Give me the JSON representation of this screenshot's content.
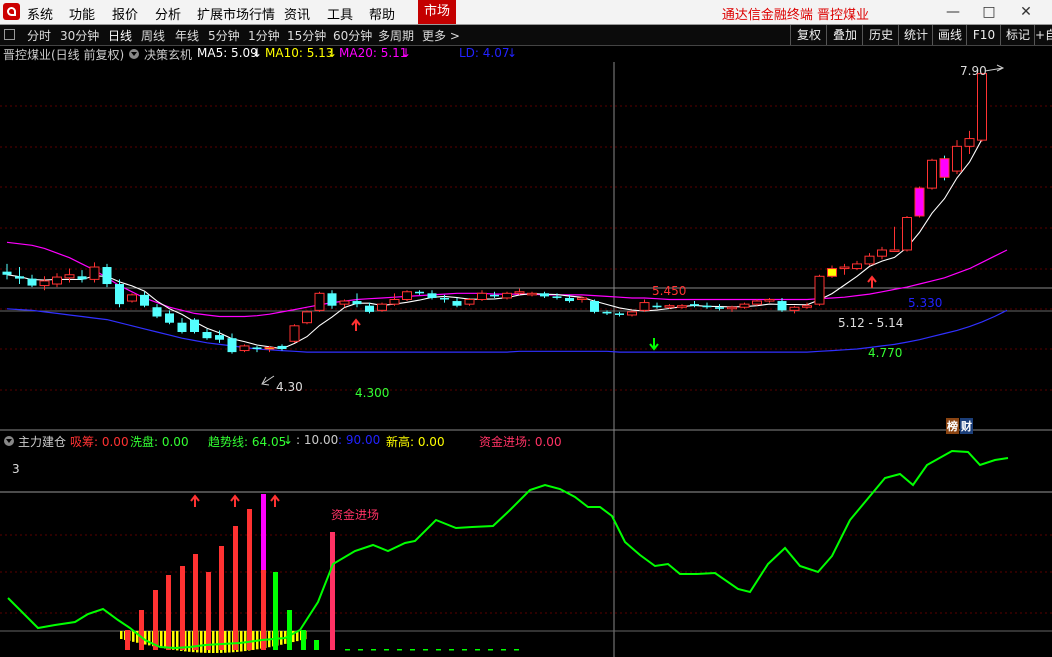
{
  "menubar": {
    "items": [
      "系统",
      "功能",
      "报价",
      "分析",
      "扩展市场行情",
      "资讯",
      "工具",
      "帮助"
    ],
    "market": "市场",
    "brand": "通达信金融终端  晋控煤业"
  },
  "timeframes": {
    "items": [
      "分时",
      "30分钟",
      "日线",
      "周线",
      "年线",
      "5分钟",
      "1分钟",
      "15分钟",
      "60分钟",
      "多周期",
      "更多 >"
    ],
    "active": "日线"
  },
  "toolbar": [
    "复权",
    "叠加",
    "历史",
    "统计",
    "画线",
    "F10",
    "标记",
    "+自"
  ],
  "main_header": {
    "title": "晋控煤业(日线 前复权)",
    "indicator": "决策玄机",
    "ma5": "MA5: 5.09",
    "ma10": "MA10: 5.13",
    "ma20": "MA20: 5.11",
    "ld": "LD: 4.07"
  },
  "annotations": {
    "high": "7.90",
    "low": "4.30",
    "low_label": "4.300",
    "mid_label": "5.450",
    "blue_label": "5.330",
    "range": "5.12 - 5.14",
    "green_label": "4.770",
    "badge1": "榜",
    "badge2": "财"
  },
  "sub_header": {
    "title": "主力建仓",
    "xichou": "吸筹: 0.00",
    "xipan": "洗盘: 0.00",
    "trend": "趋势线: 64.05",
    "ten": ": 10.00",
    "ninety": ": 90.00",
    "xingao": "新高: 0.00",
    "zijin": "资金进场: 0.00",
    "scale": "3",
    "zijin_label": "资金进场"
  },
  "colors": {
    "up": "#ff3232",
    "down": "#54ffff",
    "ma_white": "#ffffff",
    "ma_magenta": "#ff00ff",
    "ld_blue": "#3030ff",
    "trend_green": "#00ff00",
    "flag_yellow": "#ffff00"
  },
  "chart_data": {
    "type": "candlestick",
    "candles": [
      {
        "o": 5.34,
        "h": 5.44,
        "l": 5.24,
        "c": 5.3
      },
      {
        "o": 5.28,
        "h": 5.4,
        "l": 5.18,
        "c": 5.25
      },
      {
        "o": 5.25,
        "h": 5.3,
        "l": 5.14,
        "c": 5.16
      },
      {
        "o": 5.16,
        "h": 5.28,
        "l": 5.1,
        "c": 5.22
      },
      {
        "o": 5.18,
        "h": 5.32,
        "l": 5.14,
        "c": 5.27
      },
      {
        "o": 5.26,
        "h": 5.38,
        "l": 5.2,
        "c": 5.3
      },
      {
        "o": 5.28,
        "h": 5.36,
        "l": 5.2,
        "c": 5.24
      },
      {
        "o": 5.24,
        "h": 5.46,
        "l": 5.2,
        "c": 5.4
      },
      {
        "o": 5.4,
        "h": 5.44,
        "l": 5.14,
        "c": 5.18
      },
      {
        "o": 5.18,
        "h": 5.24,
        "l": 4.88,
        "c": 4.92
      },
      {
        "o": 4.96,
        "h": 5.06,
        "l": 4.94,
        "c": 5.04
      },
      {
        "o": 5.04,
        "h": 5.08,
        "l": 4.88,
        "c": 4.9
      },
      {
        "o": 4.88,
        "h": 4.92,
        "l": 4.74,
        "c": 4.76
      },
      {
        "o": 4.8,
        "h": 4.84,
        "l": 4.66,
        "c": 4.68
      },
      {
        "o": 4.68,
        "h": 4.74,
        "l": 4.54,
        "c": 4.56
      },
      {
        "o": 4.72,
        "h": 4.74,
        "l": 4.54,
        "c": 4.56
      },
      {
        "o": 4.56,
        "h": 4.6,
        "l": 4.46,
        "c": 4.48
      },
      {
        "o": 4.52,
        "h": 4.58,
        "l": 4.42,
        "c": 4.46
      },
      {
        "o": 4.48,
        "h": 4.54,
        "l": 4.28,
        "c": 4.3
      },
      {
        "o": 4.32,
        "h": 4.4,
        "l": 4.3,
        "c": 4.38
      },
      {
        "o": 4.36,
        "h": 4.38,
        "l": 4.3,
        "c": 4.34
      },
      {
        "o": 4.34,
        "h": 4.38,
        "l": 4.3,
        "c": 4.36
      },
      {
        "o": 4.38,
        "h": 4.4,
        "l": 4.32,
        "c": 4.34
      },
      {
        "o": 4.44,
        "h": 4.66,
        "l": 4.42,
        "c": 4.64
      },
      {
        "o": 4.68,
        "h": 4.84,
        "l": 4.66,
        "c": 4.82
      },
      {
        "o": 4.84,
        "h": 5.08,
        "l": 4.82,
        "c": 5.06
      },
      {
        "o": 5.06,
        "h": 5.1,
        "l": 4.86,
        "c": 4.9
      },
      {
        "o": 4.92,
        "h": 4.98,
        "l": 4.88,
        "c": 4.96
      },
      {
        "o": 4.96,
        "h": 5.06,
        "l": 4.88,
        "c": 4.92
      },
      {
        "o": 4.9,
        "h": 4.94,
        "l": 4.8,
        "c": 4.82
      },
      {
        "o": 4.84,
        "h": 4.94,
        "l": 4.82,
        "c": 4.92
      },
      {
        "o": 4.92,
        "h": 5.06,
        "l": 4.9,
        "c": 4.98
      },
      {
        "o": 4.98,
        "h": 5.1,
        "l": 4.96,
        "c": 5.08
      },
      {
        "o": 5.08,
        "h": 5.1,
        "l": 5.04,
        "c": 5.06
      },
      {
        "o": 5.06,
        "h": 5.1,
        "l": 4.98,
        "c": 5.0
      },
      {
        "o": 5.0,
        "h": 5.04,
        "l": 4.94,
        "c": 4.98
      },
      {
        "o": 4.96,
        "h": 5.0,
        "l": 4.88,
        "c": 4.9
      },
      {
        "o": 4.92,
        "h": 5.0,
        "l": 4.9,
        "c": 4.98
      },
      {
        "o": 4.98,
        "h": 5.1,
        "l": 4.96,
        "c": 5.06
      },
      {
        "o": 5.04,
        "h": 5.08,
        "l": 5.0,
        "c": 5.02
      },
      {
        "o": 5.0,
        "h": 5.08,
        "l": 4.98,
        "c": 5.06
      },
      {
        "o": 5.06,
        "h": 5.12,
        "l": 5.04,
        "c": 5.08
      },
      {
        "o": 5.04,
        "h": 5.08,
        "l": 5.02,
        "c": 5.06
      },
      {
        "o": 5.06,
        "h": 5.08,
        "l": 5.0,
        "c": 5.02
      },
      {
        "o": 5.02,
        "h": 5.06,
        "l": 4.98,
        "c": 5.0
      },
      {
        "o": 5.0,
        "h": 5.04,
        "l": 4.94,
        "c": 4.96
      },
      {
        "o": 4.98,
        "h": 5.02,
        "l": 4.94,
        "c": 5.0
      },
      {
        "o": 4.96,
        "h": 4.98,
        "l": 4.8,
        "c": 4.82
      },
      {
        "o": 4.82,
        "h": 4.84,
        "l": 4.78,
        "c": 4.8
      },
      {
        "o": 4.8,
        "h": 4.82,
        "l": 4.76,
        "c": 4.78
      },
      {
        "o": 4.78,
        "h": 4.84,
        "l": 4.76,
        "c": 4.82
      },
      {
        "o": 4.84,
        "h": 4.98,
        "l": 4.82,
        "c": 4.94
      },
      {
        "o": 4.9,
        "h": 4.94,
        "l": 4.86,
        "c": 4.88
      },
      {
        "o": 4.88,
        "h": 4.92,
        "l": 4.86,
        "c": 4.9
      },
      {
        "o": 4.88,
        "h": 4.92,
        "l": 4.86,
        "c": 4.9
      },
      {
        "o": 4.92,
        "h": 4.96,
        "l": 4.88,
        "c": 4.9
      },
      {
        "o": 4.9,
        "h": 4.94,
        "l": 4.86,
        "c": 4.88
      },
      {
        "o": 4.88,
        "h": 4.92,
        "l": 4.84,
        "c": 4.86
      },
      {
        "o": 4.86,
        "h": 4.9,
        "l": 4.82,
        "c": 4.88
      },
      {
        "o": 4.88,
        "h": 4.94,
        "l": 4.86,
        "c": 4.92
      },
      {
        "o": 4.92,
        "h": 4.98,
        "l": 4.9,
        "c": 4.96
      },
      {
        "o": 4.96,
        "h": 5.0,
        "l": 4.94,
        "c": 4.98
      },
      {
        "o": 4.96,
        "h": 5.0,
        "l": 4.82,
        "c": 4.84
      },
      {
        "o": 4.84,
        "h": 4.9,
        "l": 4.8,
        "c": 4.88
      },
      {
        "o": 4.88,
        "h": 4.94,
        "l": 4.86,
        "c": 4.9
      },
      {
        "o": 4.92,
        "h": 5.3,
        "l": 4.9,
        "c": 5.28
      },
      {
        "o": 5.28,
        "h": 5.42,
        "l": 5.26,
        "c": 5.38
      },
      {
        "o": 5.38,
        "h": 5.44,
        "l": 5.3,
        "c": 5.4
      },
      {
        "o": 5.38,
        "h": 5.48,
        "l": 5.36,
        "c": 5.44
      },
      {
        "o": 5.44,
        "h": 5.58,
        "l": 5.42,
        "c": 5.54
      },
      {
        "o": 5.54,
        "h": 5.66,
        "l": 5.5,
        "c": 5.62
      },
      {
        "o": 5.62,
        "h": 5.92,
        "l": 5.6,
        "c": 5.62
      },
      {
        "o": 5.62,
        "h": 6.06,
        "l": 5.6,
        "c": 6.04
      },
      {
        "o": 6.06,
        "h": 6.44,
        "l": 6.04,
        "c": 6.42
      },
      {
        "o": 6.42,
        "h": 6.8,
        "l": 6.4,
        "c": 6.78
      },
      {
        "o": 6.8,
        "h": 6.84,
        "l": 6.52,
        "c": 6.56
      },
      {
        "o": 6.64,
        "h": 7.04,
        "l": 6.6,
        "c": 6.96
      },
      {
        "o": 6.96,
        "h": 7.16,
        "l": 6.86,
        "c": 7.06
      },
      {
        "o": 7.04,
        "h": 7.9,
        "l": 7.02,
        "c": 7.9
      }
    ],
    "flags": [
      {
        "i": 21,
        "kind": "yellow"
      },
      {
        "i": 66,
        "kind": "yellow"
      },
      {
        "i": 73,
        "kind": "magenta"
      },
      {
        "i": 75,
        "kind": "magenta"
      },
      {
        "i": 79,
        "kind": "yellow"
      }
    ],
    "ma20": [
      5.72,
      5.7,
      5.68,
      5.64,
      5.58,
      5.52,
      5.44,
      5.36,
      5.26,
      5.16,
      5.08,
      5.0,
      4.94,
      4.88,
      4.84,
      4.8,
      4.78,
      4.76,
      4.76,
      4.76,
      4.77,
      4.79,
      4.82,
      4.85,
      4.88,
      4.91,
      4.94,
      4.96,
      4.98,
      4.99,
      5.0,
      5.01,
      5.02,
      5.03,
      5.04,
      5.05,
      5.06,
      5.06,
      5.06,
      5.05,
      5.05,
      5.05,
      5.05,
      5.04,
      5.04,
      5.04,
      5.04,
      5.03,
      5.02,
      5.01,
      5.0,
      5.0,
      4.99,
      4.98,
      4.98,
      4.98,
      4.98,
      4.98,
      4.98,
      4.98,
      4.98,
      4.98,
      4.98,
      4.98,
      4.98,
      4.99,
      5.0,
      5.01,
      5.03,
      5.05,
      5.08,
      5.11,
      5.14,
      5.18,
      5.22,
      5.26,
      5.32,
      5.38,
      5.46,
      5.54,
      5.62
    ],
    "ld": [
      4.86,
      4.85,
      4.84,
      4.82,
      4.8,
      4.78,
      4.76,
      4.74,
      4.72,
      4.68,
      4.64,
      4.6,
      4.56,
      4.52,
      4.48,
      4.45,
      4.42,
      4.4,
      4.38,
      4.36,
      4.34,
      4.33,
      4.32,
      4.31,
      4.3,
      4.3,
      4.3,
      4.3,
      4.3,
      4.3,
      4.3,
      4.3,
      4.3,
      4.3,
      4.3,
      4.3,
      4.3,
      4.3,
      4.3,
      4.3,
      4.3,
      4.31,
      4.31,
      4.31,
      4.31,
      4.31,
      4.31,
      4.31,
      4.31,
      4.3,
      4.3,
      4.3,
      4.3,
      4.3,
      4.3,
      4.3,
      4.3,
      4.3,
      4.3,
      4.3,
      4.3,
      4.3,
      4.3,
      4.3,
      4.3,
      4.31,
      4.32,
      4.33,
      4.34,
      4.36,
      4.38,
      4.4,
      4.43,
      4.46,
      4.5,
      4.54,
      4.58,
      4.63,
      4.69,
      4.76,
      4.84
    ],
    "trend": [
      12,
      9,
      5,
      2,
      1,
      2,
      5,
      7,
      8,
      6,
      5,
      4,
      6,
      9,
      15,
      22,
      28,
      34,
      36,
      38,
      38,
      37,
      36,
      38,
      47,
      62,
      67,
      65,
      70,
      72,
      76,
      85,
      85,
      85,
      86,
      96,
      102,
      106,
      104,
      108,
      108,
      100,
      89,
      78,
      71,
      70,
      68,
      68,
      66,
      62,
      61,
      66,
      76,
      86,
      82,
      74,
      69,
      72,
      92,
      105,
      115,
      120,
      120,
      116,
      123,
      131,
      134,
      130,
      134,
      136
    ],
    "trend_x": [
      8,
      17,
      25,
      33,
      41,
      49,
      57,
      65,
      73,
      81,
      89,
      97,
      105,
      113,
      121,
      129,
      137,
      145,
      153,
      161,
      169,
      177,
      185,
      193,
      201,
      209,
      217,
      225,
      233,
      241,
      249,
      257,
      265,
      273,
      281,
      289,
      297,
      305,
      313,
      321,
      329,
      337,
      345,
      353,
      361,
      369,
      377,
      385,
      393,
      401,
      409,
      417,
      425,
      433,
      441,
      449,
      457,
      465,
      473,
      481,
      489,
      497,
      505,
      513,
      521,
      529,
      537,
      545,
      553,
      561
    ],
    "bars_red": [
      0,
      0,
      0,
      0,
      0,
      0,
      0,
      0,
      0,
      0,
      0,
      0,
      0,
      0,
      0,
      0,
      0,
      1,
      3,
      4,
      5,
      6,
      8,
      9,
      12,
      13,
      15,
      0,
      0,
      0,
      0,
      0,
      0,
      0,
      0,
      0,
      0,
      0,
      0,
      0,
      0,
      0,
      0,
      0,
      0,
      0,
      0,
      0,
      0,
      0,
      0,
      0,
      0,
      0,
      0,
      0,
      0,
      0,
      0,
      0,
      0,
      0,
      0,
      0,
      0,
      0,
      0,
      0,
      0,
      0
    ],
    "bars_green": [
      0,
      0,
      0,
      0,
      0,
      0,
      0,
      0,
      0,
      0,
      0,
      0,
      0,
      0,
      0,
      0,
      0,
      0,
      0,
      0,
      0,
      0,
      0,
      0,
      0,
      0,
      0,
      0,
      5,
      3,
      2,
      1,
      0,
      0,
      0,
      0,
      0,
      0,
      0,
      0,
      0,
      0,
      0,
      0,
      0,
      0,
      0,
      0,
      0,
      0,
      0,
      0,
      0,
      0,
      0,
      0,
      0,
      0,
      0,
      0,
      0,
      0,
      0,
      0,
      0,
      0,
      0,
      0,
      0,
      0
    ]
  }
}
